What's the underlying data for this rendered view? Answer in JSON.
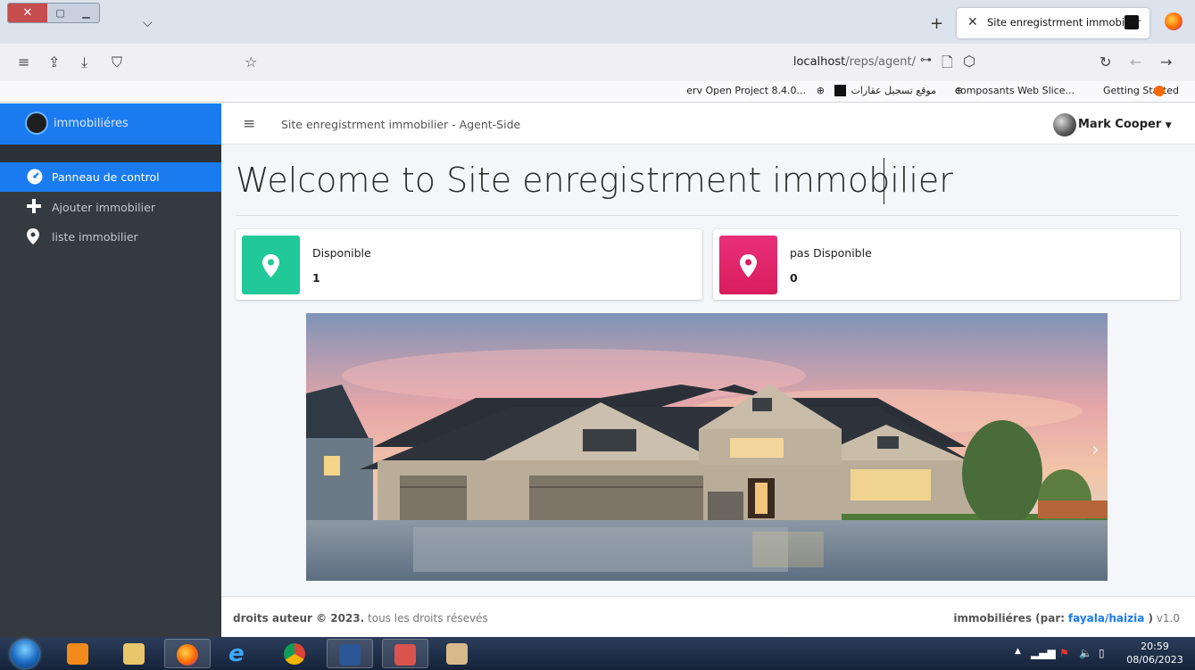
{
  "browser": {
    "tab_title": "Site enregistrment immobilier",
    "url_host": "localhost",
    "url_path": "/reps/agent/",
    "bookmarks": [
      "Getting Started",
      "composants Web Slice...",
      "موقع تسجيل عقارات",
      "erv Open Project 8.4.0..."
    ]
  },
  "sidebar": {
    "brand": "immobiliéres",
    "items": [
      {
        "label": "Panneau de control",
        "icon": "dashboard-icon",
        "active": true
      },
      {
        "label": "Ajouter immobilier",
        "icon": "plus-icon",
        "active": false
      },
      {
        "label": "liste immobilier",
        "icon": "map-marker-icon",
        "active": false
      }
    ]
  },
  "header": {
    "title": "Site enregistrment immobilier - Agent-Side",
    "user_name": "Mark Cooper"
  },
  "main": {
    "welcome": "Welcome to Site enregistrment immobilier",
    "cards": [
      {
        "label": "Disponible",
        "value": "1",
        "color": "#20c997"
      },
      {
        "label": "pas Disponible",
        "value": "0",
        "color": "#e83e8c"
      }
    ]
  },
  "footer": {
    "copyright_bold": "droits auteur © 2023.",
    "copyright_rest": " tous les droits résevés",
    "brand_bold": "immobiliéres (par:",
    "authors": "fayala/haizia",
    "brand_close": " )",
    "version": " v1.0"
  },
  "taskbar": {
    "time": "20:59",
    "date": "08/06/2023"
  },
  "colors": {
    "primary": "#1a7bf0",
    "sidebar_bg": "#343a40"
  }
}
